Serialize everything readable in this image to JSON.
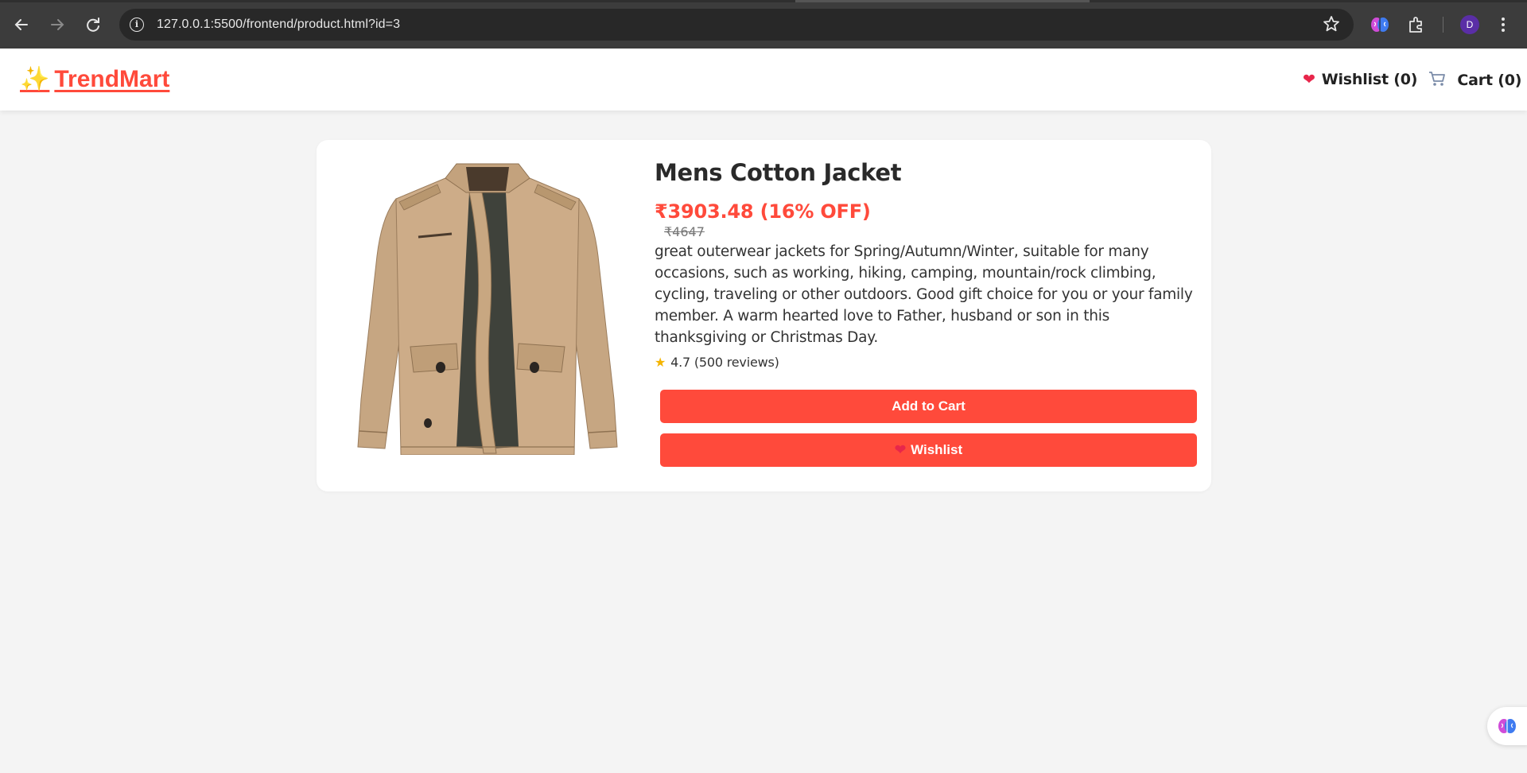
{
  "browser": {
    "url": "127.0.0.1:5500/frontend/product.html?id=3",
    "profile_initial": "D",
    "icons": {
      "back": "arrow-left-icon",
      "forward": "arrow-right-icon",
      "reload": "reload-icon",
      "site_info": "info-icon",
      "bookmark": "star-icon",
      "extension": "brain-icon",
      "extensions_menu": "puzzle-icon",
      "menu": "kebab-icon"
    }
  },
  "header": {
    "logo_text": "TrendMart",
    "logo_icon": "sparkles-icon",
    "wishlist_label": "Wishlist (0)",
    "cart_label": "Cart (0)"
  },
  "product": {
    "title": "Mens Cotton Jacket",
    "price_line": "₹3903.48 (16% OFF)",
    "original_price": "₹4647",
    "description": "great outerwear jackets for Spring/Autumn/Winter, suitable for many occasions, such as working, hiking, camping, mountain/rock climbing, cycling, traveling or other outdoors. Good gift choice for you or your family member. A warm hearted love to Father, husband or son in this thanksgiving or Christmas Day.",
    "rating_text": "4.7 (500 reviews)",
    "add_to_cart_label": "Add to Cart",
    "wishlist_button_label": "Wishlist"
  },
  "colors": {
    "accent": "#ff4a3b",
    "page_background": "#f4f4f4",
    "jacket": "#c9a987"
  }
}
